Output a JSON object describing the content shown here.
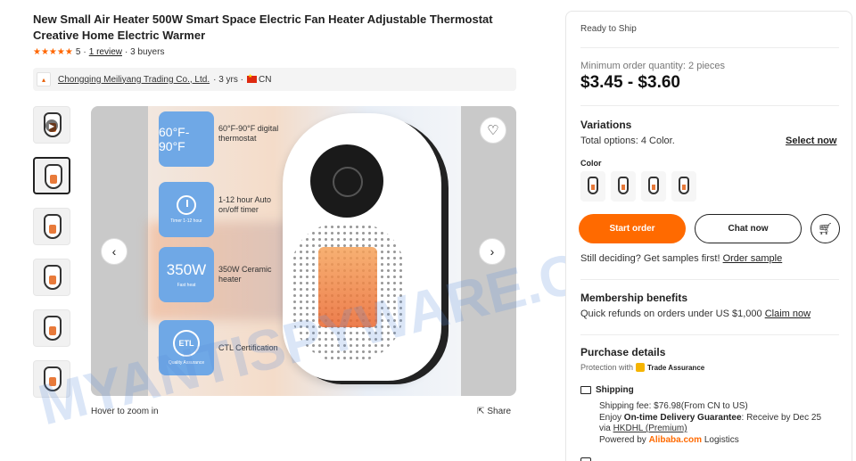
{
  "product": {
    "title": "New Small Air Heater 500W Smart Space Electric Fan Heater Adjustable Thermostat Creative Home Electric Warmer",
    "stars": "★★★★★",
    "rating": "5",
    "sep1": "·",
    "reviews_link": "1 review",
    "buyers": "· 3 buyers"
  },
  "supplier": {
    "name": "Chongqing Meiliyang Trading Co., Ltd.",
    "years": "· 3 yrs ·",
    "country": "CN"
  },
  "gallery": {
    "features": [
      {
        "badge": "60°F-90°F",
        "text": "60°F-90°F digital thermostat"
      },
      {
        "badge": "",
        "caption": "Timer 1-12 hour",
        "text": "1-12 hour Auto on/off timer"
      },
      {
        "badge": "350W",
        "caption": "Fast heat",
        "text": "350W Ceramic heater"
      },
      {
        "badge": "ETL",
        "caption": "Quality Assurance",
        "text": "CTL Certification"
      }
    ],
    "hover_zoom": "Hover to zoom in",
    "share": "Share"
  },
  "watermark": "MYANTISPYWARE.COM",
  "panel": {
    "ready": "Ready to Ship",
    "moq": "Minimum order quantity: 2 pieces",
    "price": "$3.45 - $3.60",
    "variations_title": "Variations",
    "total_options": "Total options: 4 Color.",
    "select_now": "Select now",
    "color_label": "Color",
    "start_order": "Start order",
    "chat_now": "Chat now",
    "still_deciding": "Still deciding? Get samples first!",
    "order_sample": "Order sample",
    "membership_title": "Membership benefits",
    "refund_text": "Quick refunds on orders under US $1,000",
    "claim_now": "Claim now",
    "purchase_title": "Purchase details",
    "protection": "Protection with",
    "trade_assurance": "Trade Assurance",
    "shipping_title": "Shipping",
    "shipping_fee": "Shipping fee: $76.98(From CN to US)",
    "enjoy": "Enjoy",
    "guarantee": "On-time Delivery Guarantee",
    "receive": ": Receive by Dec 25",
    "via": "via",
    "carrier": "HKDHL (Premium)",
    "powered_by": "Powered by",
    "alibaba": "Alibaba.com",
    "logistics": "Logistics"
  },
  "colors": {
    "accent": "#ff6a00",
    "stars": "#ff6600",
    "feature_tile": "#6fa8e6"
  }
}
